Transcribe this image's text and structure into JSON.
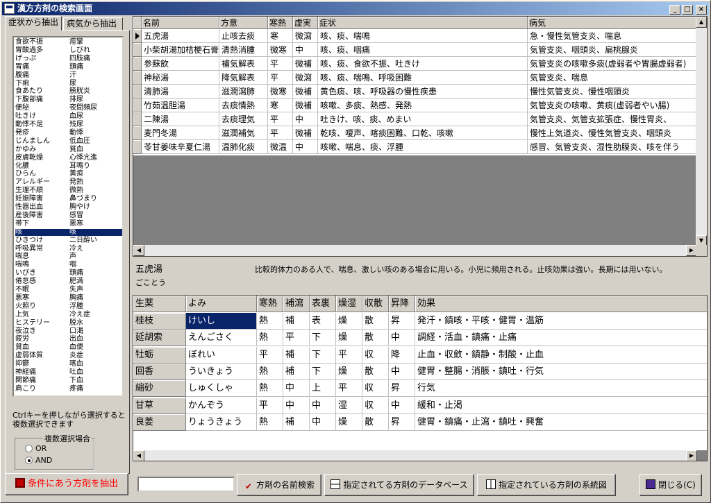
{
  "window": {
    "title": "漢方方剤の検索画面",
    "min": "_",
    "max": "□",
    "close": "×"
  },
  "tabs": [
    {
      "label": "症状から抽出"
    },
    {
      "label": "病気から抽出"
    }
  ],
  "symptom_col1": [
    "食欲不振",
    "胃酸過多",
    "げっぷ",
    "胃痛",
    "腹痛",
    "下痢",
    "食あたり",
    "下腹部痛",
    "便秘",
    "吐きけ",
    "動悸不足",
    "発疹",
    "じんましん",
    "かゆみ",
    "皮膚乾燥",
    "化膿",
    "ひらん",
    "アレルギー",
    "生理不順",
    "妊娠障害",
    "性器出血",
    "産後障害",
    "帯下",
    "咳",
    "ひきつけ",
    "呼吸異常",
    "喘息",
    "喘鳴",
    "いびき",
    "倦怠感",
    "不眠",
    "悪寒",
    "火照り",
    "上気",
    "ヒステリー",
    "夜泣き",
    "疲労",
    "貧血",
    "虚弱体質",
    "抑鬱",
    "神経痛",
    "関節痛",
    "肩こり"
  ],
  "symptom_col2": [
    "痙攣",
    "しびれ",
    "四肢痛",
    "頭痛",
    "汗",
    "尿",
    "膀胱炎",
    "排尿",
    "夜間頻尿",
    "血尿",
    "残尿",
    "動悸",
    "低血圧",
    "貧血",
    "心悸亢進",
    "耳鳴り",
    "黄疸",
    "発熱",
    "微熱",
    "鼻づまり",
    "胸やけ",
    "感冒",
    "悪寒",
    "咳",
    "二日酔い",
    "冷え",
    "声",
    "咽",
    "頭痛",
    "肥満",
    "失声",
    "胸痛",
    "浮腫",
    "冷え症",
    "脱水",
    "口渇",
    "出血",
    "血便",
    "炎症",
    "喀血",
    "吐血",
    "下血",
    "疼痛"
  ],
  "selected_index": 23,
  "note": "Ctrlキーを押しながら選択すると複数選択できます",
  "multi_select": {
    "label": "複数選択場合",
    "options": [
      "OR",
      "AND"
    ],
    "selected": "AND"
  },
  "extract_button": "条件にあう方剤を抽出",
  "grid1": {
    "headers": [
      "名前",
      "方意",
      "寒熱",
      "虚実",
      "症状",
      "病気"
    ],
    "rows": [
      [
        "五虎湯",
        "止咳去痰",
        "寒",
        "微瀉",
        "咳、痰、喘鳴",
        "急・慢性気管支炎、喘息"
      ],
      [
        "小柴胡湯加桔梗石膏",
        "清熱消腫",
        "微寒",
        "中",
        "咳、痰、咽痛",
        "気管支炎、咽頭炎、扁桃腺炎"
      ],
      [
        "参蘇飲",
        "補気解表",
        "平",
        "微補",
        "咳、痰、食欲不振、吐きけ",
        "気管支炎の咳嗽多痰(虚弱者や胃腸虚弱者)"
      ],
      [
        "神秘湯",
        "降気解表",
        "平",
        "微瀉",
        "咳、痰、喘鳴、呼吸困難",
        "気管支炎、喘息"
      ],
      [
        "清肺湯",
        "滋潤瀉肺",
        "微寒",
        "微補",
        "黄色痰、咳、呼吸器の慢性疾患",
        "慢性気管支炎、慢性咽頭炎"
      ],
      [
        "竹茹温胆湯",
        "去痰情熱",
        "寒",
        "微補",
        "咳嗽、多痰、熱感、発熱",
        "気管支炎の咳嗽、黄痰(虚弱者やい腸)"
      ],
      [
        "二陳湯",
        "去痰理気",
        "平",
        "中",
        "吐きけ、咳、痰、めまい",
        "気管支炎、気管支拡張症、慢性胃炎、"
      ],
      [
        "麦門冬湯",
        "滋潤補気",
        "平",
        "微補",
        "乾咳、嗄声、喀痰困難、口乾、咳嗽",
        "慢性上気道炎、慢性気管支炎、咽頭炎"
      ],
      [
        "苓甘姜味辛夏仁湯",
        "温肺化痰",
        "微温",
        "中",
        "咳嗽、喘息、痰、浮腫",
        "感冒、気管支炎、湿性肋膜炎、咳を伴う"
      ]
    ]
  },
  "selected_formula": {
    "name": "五虎湯",
    "reading": "ごことう",
    "description": "比較的体力のある人で、喘息、激しい咳のある場合に用いる。小児に頻用される。止咳効果は強い。長期には用いない。"
  },
  "grid2": {
    "headers": [
      "生薬",
      "よみ",
      "寒熱",
      "補瀉",
      "表裏",
      "燥湿",
      "収散",
      "昇降",
      "効果"
    ],
    "rows": [
      [
        "桂枝",
        "けいし",
        "熱",
        "補",
        "表",
        "燥",
        "散",
        "昇",
        "発汗・鎮咳・平咳・健胃・温筋"
      ],
      [
        "延胡索",
        "えんごさく",
        "熱",
        "平",
        "下",
        "燥",
        "散",
        "中",
        "調経・活血・鎮痛・止痛"
      ],
      [
        "牡蛎",
        "ぼれい",
        "平",
        "補",
        "下",
        "平",
        "収",
        "降",
        "止血・収斂・鎮静・制酸・止血"
      ],
      [
        "回香",
        "ういきょう",
        "熱",
        "補",
        "下",
        "燥",
        "散",
        "中",
        "健胃・整腸・消脹・鎮吐・行気"
      ],
      [
        "縮砂",
        "しゅくしゃ",
        "熱",
        "中",
        "上",
        "平",
        "収",
        "昇",
        "行気"
      ],
      [
        "甘草",
        "かんぞう",
        "平",
        "中",
        "中",
        "湿",
        "収",
        "中",
        "緩和・止渇"
      ],
      [
        "良姜",
        "りょうきょう",
        "熱",
        "補",
        "中",
        "燥",
        "散",
        "昇",
        "健胃・鎮痛・止瀉・鎮吐・興奮"
      ]
    ]
  },
  "bottom": {
    "search_value": "",
    "name_search": "方剤の名前検索",
    "database": "指定されてる方剤のデータベース",
    "system_chart": "指定されている方剤の系統図",
    "close": "閉じる(C)"
  },
  "colors": {
    "titlebar": "#0a246a",
    "selection": "#0a246a",
    "face": "#d4d0c8",
    "extract_text": "#ff0000"
  }
}
